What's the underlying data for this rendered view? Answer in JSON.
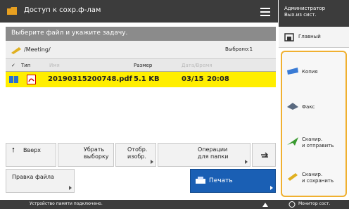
{
  "header": {
    "title": "Доступ к сохр.ф-лам"
  },
  "admin": {
    "line1": "Администратор",
    "line2": "Вых.из сист."
  },
  "home": {
    "label": "Главный"
  },
  "instruction": "Выберите файл и укажите задачу.",
  "path": {
    "text": "/Meeting/",
    "selected": "Выбрано:1"
  },
  "columns": {
    "type": "Тип",
    "name": "Имя",
    "size": "Размер",
    "datetime": "Дата/Время"
  },
  "files": [
    {
      "name": "20190315200748.pdf",
      "size": "5.1 KB",
      "date": "03/15",
      "time": "20:08"
    }
  ],
  "buttons": {
    "up": "Вверх",
    "deselect_1": "Убрать",
    "deselect_2": "выборку",
    "display_1": "Отобр.",
    "display_2": "изобр.",
    "folder_1": "Операции",
    "folder_2": "для папки",
    "edit": "Правка файла",
    "print": "Печать"
  },
  "side_actions": [
    {
      "line1": "Копия",
      "line2": ""
    },
    {
      "line1": "Факс",
      "line2": ""
    },
    {
      "line1": "Сканир.",
      "line2": "и отправить"
    },
    {
      "line1": "Сканир.",
      "line2": "и сохранить"
    }
  ],
  "status": {
    "message": "Устройство памяти подключено.",
    "monitor": "Монитор сост."
  },
  "colors": {
    "accent": "#ffee00",
    "panel_border": "#f0b030",
    "print_button": "#1a5fb4"
  }
}
